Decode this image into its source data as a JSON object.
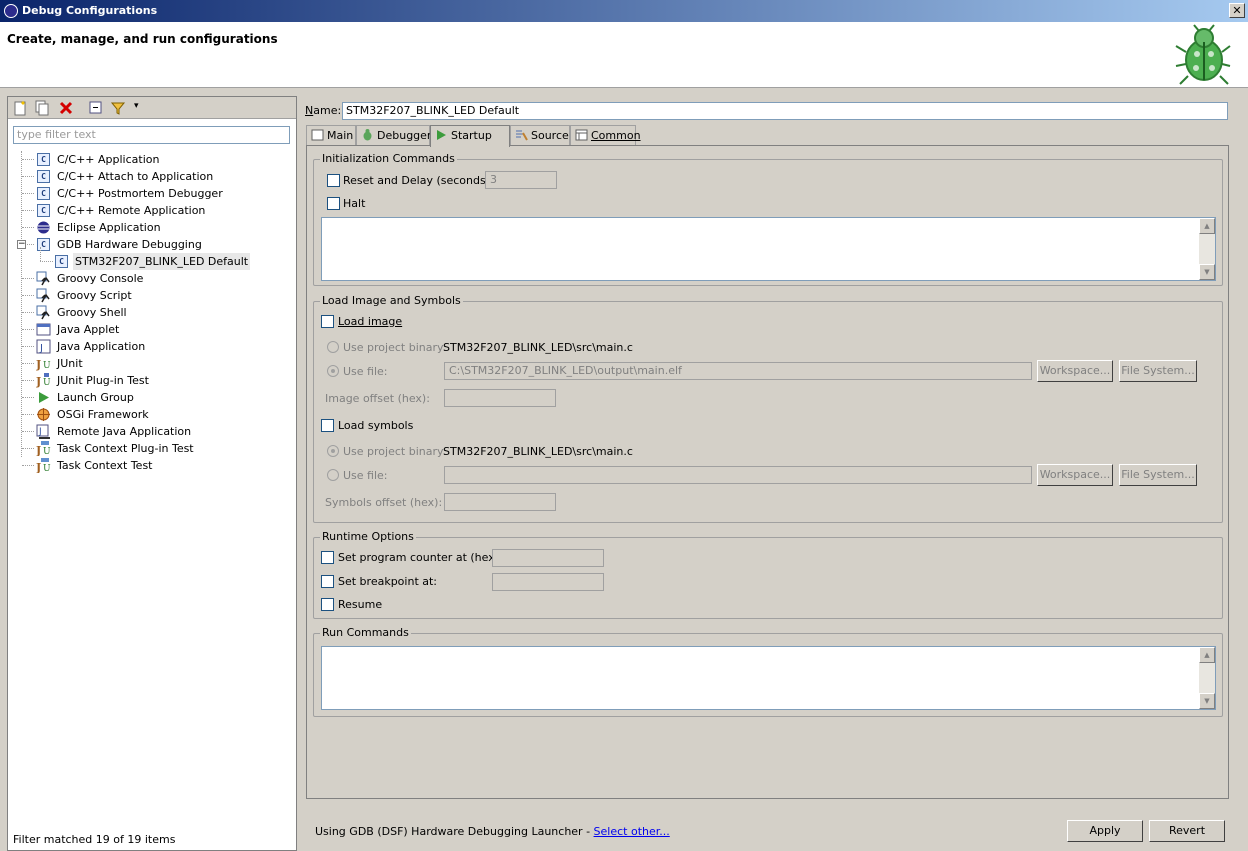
{
  "window": {
    "title": "Debug Configurations",
    "close_label": "✕"
  },
  "header": {
    "title": "Create, manage, and run configurations"
  },
  "left": {
    "filter_placeholder": "type filter text",
    "status": "Filter matched 19 of 19 items",
    "tree": [
      {
        "label": "C/C++ Application",
        "icon": "c-config-icon"
      },
      {
        "label": "C/C++ Attach to Application",
        "icon": "c-config-icon"
      },
      {
        "label": "C/C++ Postmortem Debugger",
        "icon": "c-config-icon"
      },
      {
        "label": "C/C++ Remote Application",
        "icon": "c-config-icon"
      },
      {
        "label": "Eclipse Application",
        "icon": "eclipse-icon"
      },
      {
        "label": "GDB Hardware Debugging",
        "icon": "c-config-icon",
        "expanded": true
      },
      {
        "label": "STM32F207_BLINK_LED Default",
        "icon": "c-config-icon",
        "child": true,
        "selected": true
      },
      {
        "label": "Groovy Console",
        "icon": "groovy-icon"
      },
      {
        "label": "Groovy Script",
        "icon": "groovy-icon"
      },
      {
        "label": "Groovy Shell",
        "icon": "groovy-icon"
      },
      {
        "label": "Java Applet",
        "icon": "applet-icon"
      },
      {
        "label": "Java Application",
        "icon": "java-app-icon"
      },
      {
        "label": "JUnit",
        "icon": "junit-icon"
      },
      {
        "label": "JUnit Plug-in Test",
        "icon": "junit-plugin-icon"
      },
      {
        "label": "Launch Group",
        "icon": "launch-group-icon"
      },
      {
        "label": "OSGi Framework",
        "icon": "osgi-icon"
      },
      {
        "label": "Remote Java Application",
        "icon": "remote-java-icon"
      },
      {
        "label": "Task Context Plug-in Test",
        "icon": "task-junit-icon"
      },
      {
        "label": "Task Context Test",
        "icon": "task-junit-icon"
      }
    ]
  },
  "config": {
    "name_label": "Name:",
    "name_value": "STM32F207_BLINK_LED Default",
    "tabs": [
      {
        "label": "Main",
        "icon": "main-tab-icon"
      },
      {
        "label": "Debugger",
        "icon": "bug-tab-icon"
      },
      {
        "label": "Startup",
        "icon": "run-tab-icon",
        "active": true
      },
      {
        "label": "Source",
        "icon": "source-tab-icon"
      },
      {
        "label": "Common",
        "icon": "common-tab-icon"
      }
    ]
  },
  "startup": {
    "init": {
      "title": "Initialization Commands",
      "reset_label": "Reset and Delay (seconds):",
      "reset_value": "3",
      "halt_label": "Halt"
    },
    "load": {
      "title": "Load Image and Symbols",
      "load_image_label": "Load image",
      "use_project_binary_label": "Use project binary:",
      "image_project_binary": "STM32F207_BLINK_LED\\src\\main.c",
      "use_file_label": "Use file:",
      "image_file_value": "C:\\STM32F207_BLINK_LED\\output\\main.elf",
      "workspace_label": "Workspace...",
      "filesystem_label": "File System...",
      "image_offset_label": "Image offset (hex):",
      "load_symbols_label": "Load symbols",
      "symbols_project_binary": "STM32F207_BLINK_LED\\src\\main.c",
      "symbols_offset_label": "Symbols offset (hex):"
    },
    "runtime": {
      "title": "Runtime Options",
      "set_pc_label": "Set program counter at (hex):",
      "set_bp_label": "Set breakpoint at:",
      "resume_label": "Resume"
    },
    "run": {
      "title": "Run Commands"
    }
  },
  "footer": {
    "launcher_text": "Using GDB (DSF) Hardware Debugging Launcher - ",
    "select_other": "Select other...",
    "apply": "Apply",
    "revert": "Revert"
  }
}
